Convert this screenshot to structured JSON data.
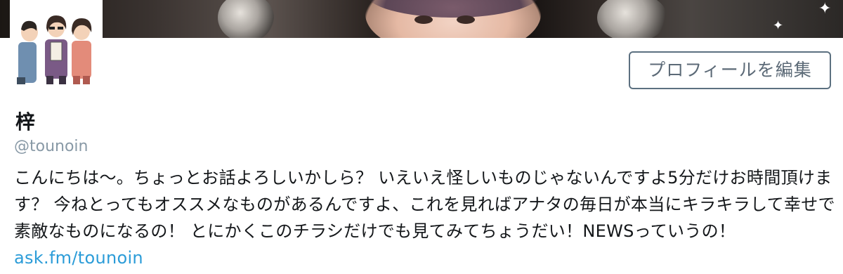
{
  "profile": {
    "display_name": "梓",
    "handle": "@tounoin",
    "bio_text": "こんにちは〜。ちょっとお話よろしいかしら？ いえいえ怪しいものじゃないんですよ5分だけお時間頂けます？ 今ねとってもオススメなものがあるんですよ、これを見ればアナタの毎日が本当にキラキラして幸せで素敵なものになるの！ とにかくこのチラシだけでも見てみてちょうだい！NEWSっていうの！",
    "bio_link": "ask.fm/tounoin"
  },
  "actions": {
    "edit_profile_label": "プロフィールを編集"
  },
  "colors": {
    "link": "#2b9cd8",
    "handle": "#8899a6",
    "button_border": "#5c7080",
    "button_text": "#5c6a77"
  }
}
